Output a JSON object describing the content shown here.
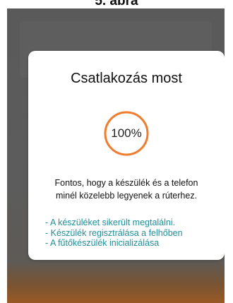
{
  "caption": "5. ábra",
  "dialog": {
    "title": "Csatlakozás most",
    "progress": {
      "value_percent": 100,
      "label": "100%",
      "color": "#f07d2e"
    },
    "info_line1": "Fontos, hogy a készülék és a telefon",
    "info_line2": "minél közelebb legyenek a rúterhez.",
    "steps": [
      "- A készüléket sikerült megtalálni.",
      "- Készülék regisztrálása a felhőben",
      "- A fűtőkészülék inicializálása"
    ],
    "step_color": "#1e8f9a"
  }
}
